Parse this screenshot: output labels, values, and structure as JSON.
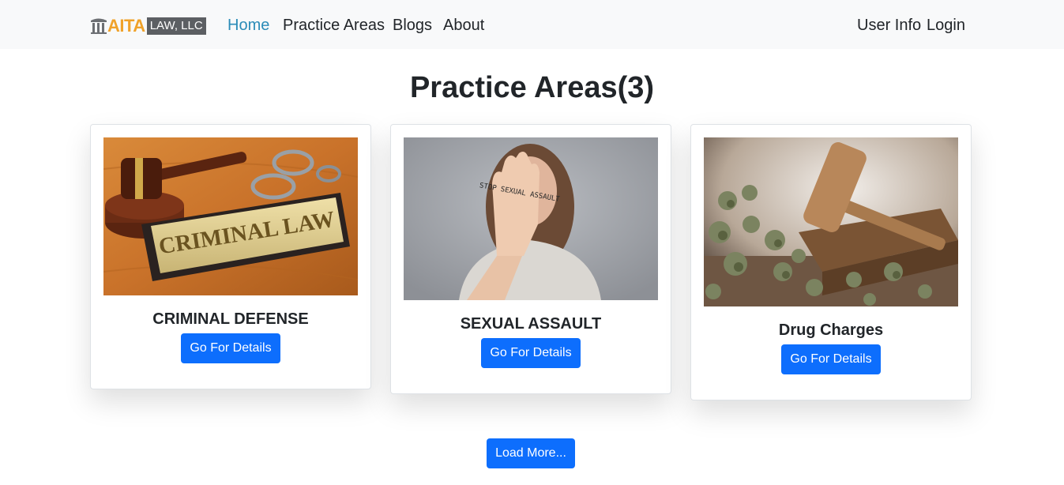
{
  "brand": {
    "name": "AITA",
    "suffix": "LAW, LLC"
  },
  "nav": {
    "home": "Home",
    "practice_areas": "Practice Areas",
    "blogs": "Blogs",
    "about": "About",
    "user_info": "User Info",
    "login": "Login"
  },
  "main": {
    "title": "Practice Areas(3)",
    "cards": [
      {
        "title": "CRIMINAL DEFENSE",
        "image_text": "CRIMINAL LAW",
        "button": "Go For Details"
      },
      {
        "title": "SEXUAL ASSAULT",
        "image_text": "STOP SEXUAL ASSAULT",
        "button": "Go For Details"
      },
      {
        "title": "Drug Charges",
        "button": "Go For Details"
      }
    ],
    "load_more": "Load More..."
  },
  "colors": {
    "primary": "#0d6efd",
    "nav_active": "#2b8cb8",
    "brand_orange": "#f0a22a",
    "navbar_bg": "#f8f9fa"
  }
}
